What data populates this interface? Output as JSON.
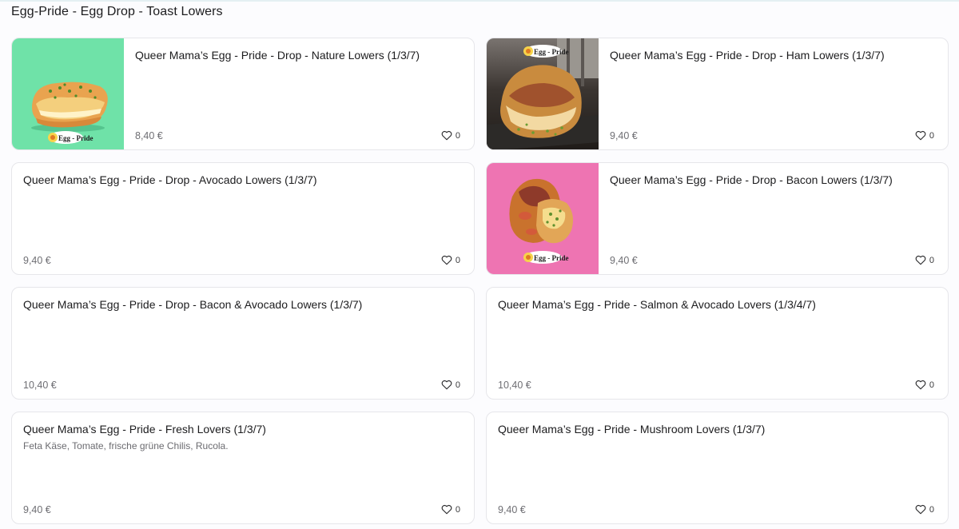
{
  "section": {
    "title": "Egg-Pride - Egg Drop - Toast Lowers"
  },
  "products": [
    {
      "title": "Queer Mama’s Egg - Pride - Drop - Nature Lowers (1/3/7)",
      "description": "",
      "price": "8,40 €",
      "likes": "0",
      "image": "nature",
      "logo_text": "Egg - Pride"
    },
    {
      "title": "Queer Mama’s Egg - Pride - Drop - Ham Lowers (1/3/7)",
      "description": "",
      "price": "9,40 €",
      "likes": "0",
      "image": "ham",
      "logo_text": "Egg - Pride"
    },
    {
      "title": "Queer Mama’s Egg - Pride - Drop - Avocado Lowers (1/3/7)",
      "description": "",
      "price": "9,40 €",
      "likes": "0",
      "image": ""
    },
    {
      "title": "Queer Mama’s Egg - Pride - Drop - Bacon Lowers (1/3/7)",
      "description": "",
      "price": "9,40 €",
      "likes": "0",
      "image": "bacon",
      "logo_text": "Egg - Pride"
    },
    {
      "title": "Queer Mama’s Egg - Pride - Drop - Bacon & Avocado Lowers (1/3/7)",
      "description": "",
      "price": "10,40 €",
      "likes": "0",
      "image": ""
    },
    {
      "title": "Queer Mama’s Egg - Pride - Salmon & Avocado Lovers (1/3/4/7)",
      "description": "",
      "price": "10,40 €",
      "likes": "0",
      "image": ""
    },
    {
      "title": "Queer Mama’s Egg - Pride - Fresh Lovers (1/3/7)",
      "description": "Feta Käse, Tomate, frische grüne Chilis, Rucola.",
      "price": "9,40 €",
      "likes": "0",
      "image": ""
    },
    {
      "title": "Queer Mama’s Egg - Pride - Mushroom Lovers (1/3/7)",
      "description": "",
      "price": "9,40 €",
      "likes": "0",
      "image": ""
    }
  ],
  "icons": {
    "like": "heart-outline-icon"
  },
  "colors": {
    "nature_bg": "#6fe2a8",
    "bacon_bg": "#ee74b2",
    "ham_bg": "#2a2622"
  }
}
